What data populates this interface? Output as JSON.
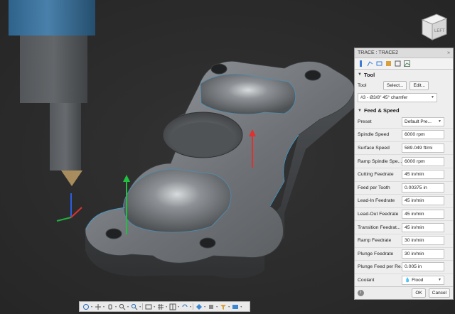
{
  "viewcube": {
    "face_label": "LEFT"
  },
  "panel": {
    "title": "TRACE : TRACE2",
    "tabs": [
      "tool-tab-icon",
      "geometry-tab-icon",
      "heights-tab-icon",
      "passes-tab-icon",
      "linking-tab-icon",
      "simulation-tab-icon"
    ],
    "tool_section": {
      "title": "Tool",
      "tool_label": "Tool",
      "select_button": "Select...",
      "edit_button": "Edit...",
      "tool_selection": "#3 - Ø3/8\" 45° chamfer"
    },
    "feed_section": {
      "title": "Feed & Speed",
      "preset_label": "Preset",
      "preset_value": "Default Pre...",
      "fields": [
        {
          "label": "Spindle Speed",
          "value": "6000 rpm"
        },
        {
          "label": "Surface Speed",
          "value": "589.049 ft/mi"
        },
        {
          "label": "Ramp Spindle Spe...",
          "value": "6000 rpm"
        },
        {
          "label": "Cutting Feedrate",
          "value": "45 in/min"
        },
        {
          "label": "Feed per Tooth",
          "value": "0.00375 in"
        },
        {
          "label": "Lead-In Feedrate",
          "value": "45 in/min"
        },
        {
          "label": "Lead-Out Feedrate",
          "value": "45 in/min"
        },
        {
          "label": "Transition Feedrat...",
          "value": "45 in/min"
        },
        {
          "label": "Ramp Feedrate",
          "value": "30 in/min"
        },
        {
          "label": "Plunge Feedrate",
          "value": "30 in/min"
        },
        {
          "label": "Plunge Feed per Re...",
          "value": "0.005 in"
        }
      ],
      "coolant_label": "Coolant",
      "coolant_value": "Flood"
    },
    "ok_button": "OK",
    "cancel_button": "Cancel"
  },
  "toolbar": {
    "icons": [
      "orbit-icon",
      "pan-icon",
      "hand-icon",
      "zoom-icon",
      "zoom-window-icon",
      "display-settings-icon",
      "grid-icon",
      "viewports-icon",
      "camera-icon",
      "visual-style-icon",
      "effects-icon",
      "filter-icon",
      "section-icon"
    ]
  }
}
